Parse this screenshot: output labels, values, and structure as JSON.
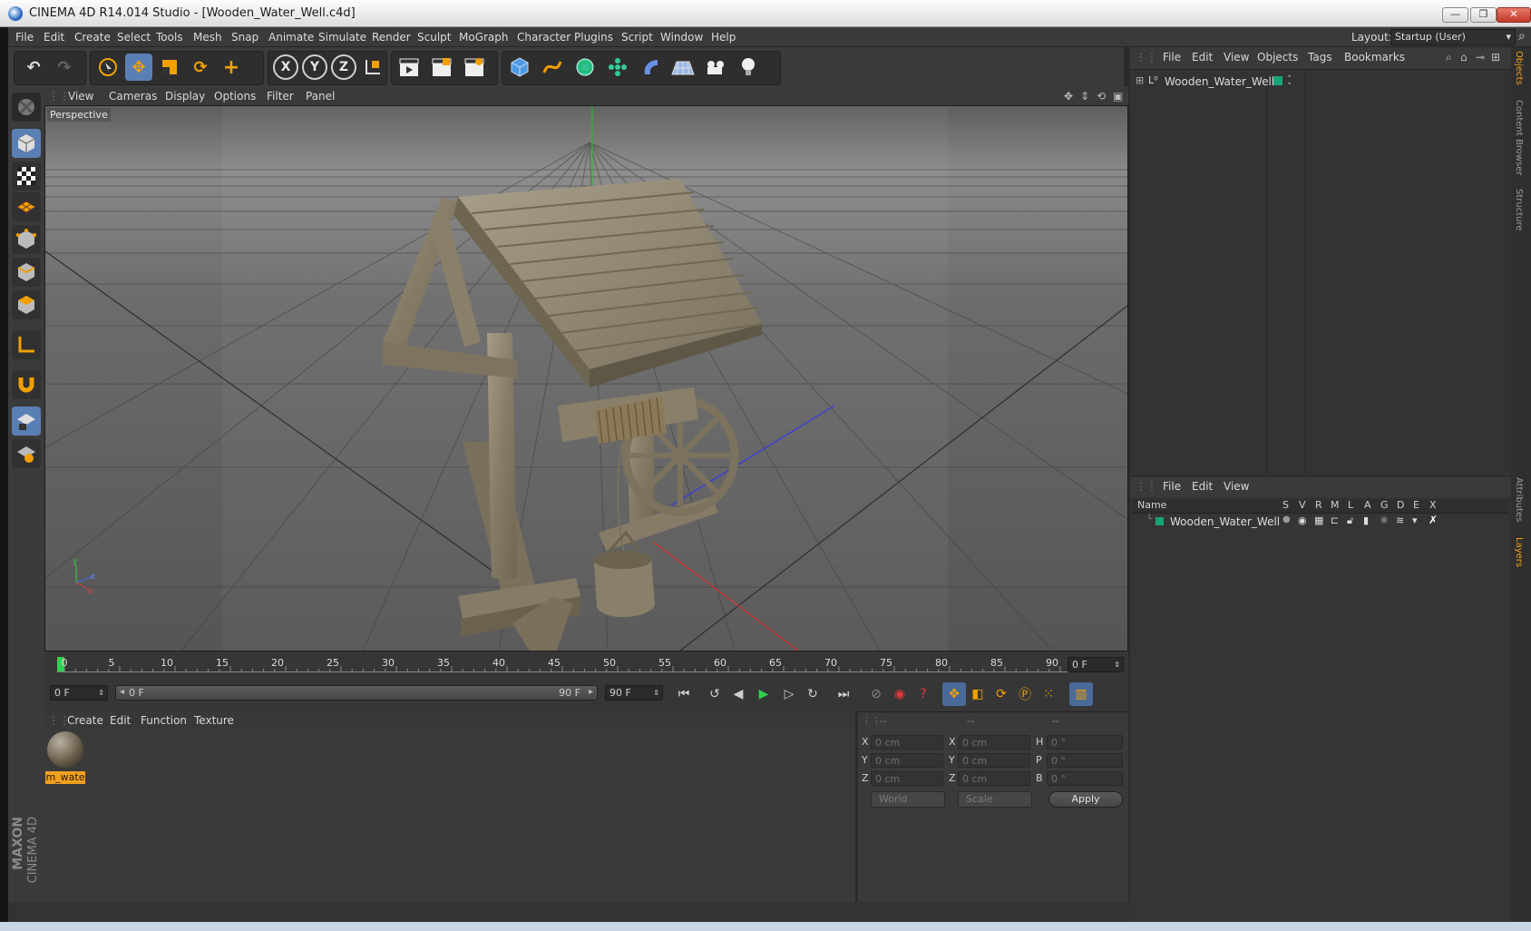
{
  "window": {
    "title": "CINEMA 4D R14.014 Studio - [Wooden_Water_Well.c4d]",
    "minimize": "—",
    "maximize": "❐",
    "close": "✕"
  },
  "menubar": [
    "File",
    "Edit",
    "Create",
    "Select",
    "Tools",
    "Mesh",
    "Snap",
    "Animate",
    "Simulate",
    "Render",
    "Sculpt",
    "MoGraph",
    "Character",
    "Plugins",
    "Script",
    "Window",
    "Help"
  ],
  "layout": {
    "label": "Layout:",
    "value": "Startup (User)"
  },
  "toolbar": {
    "axis_x": "X",
    "axis_y": "Y",
    "axis_z": "Z"
  },
  "viewport": {
    "menu": [
      "View",
      "Cameras",
      "Display",
      "Options",
      "Filter",
      "Panel"
    ],
    "label": "Perspective",
    "gizmo": {
      "x": "x",
      "y": "y",
      "z": "z"
    }
  },
  "timeline": {
    "ticks": [
      "0",
      "5",
      "10",
      "15",
      "20",
      "25",
      "30",
      "35",
      "40",
      "45",
      "50",
      "55",
      "60",
      "65",
      "70",
      "75",
      "80",
      "85",
      "90"
    ],
    "current_frame": "0 F"
  },
  "transport": {
    "start": "0 F",
    "range_start": "0 F",
    "range_end": "90 F",
    "end": "90 F"
  },
  "materials": {
    "menu": [
      "Create",
      "Edit",
      "Function",
      "Texture"
    ],
    "items": [
      {
        "label": "m_wate"
      }
    ]
  },
  "coordinates": {
    "headers": [
      "--",
      "--",
      "--"
    ],
    "rows": [
      {
        "l1": "X",
        "v1": "0 cm",
        "l2": "X",
        "v2": "0 cm",
        "l3": "H",
        "v3": "0 °"
      },
      {
        "l1": "Y",
        "v1": "0 cm",
        "l2": "Y",
        "v2": "0 cm",
        "l3": "P",
        "v3": "0 °"
      },
      {
        "l1": "Z",
        "v1": "0 cm",
        "l2": "Z",
        "v2": "0 cm",
        "l3": "B",
        "v3": "0 °"
      }
    ],
    "mode": "World",
    "transform": "Scale",
    "apply": "Apply"
  },
  "object_manager": {
    "menu": [
      "File",
      "Edit",
      "View",
      "Objects",
      "Tags",
      "Bookmarks"
    ],
    "objects": [
      {
        "name": "Wooden_Water_Well"
      }
    ]
  },
  "layer_manager": {
    "menu": [
      "File",
      "Edit",
      "View"
    ],
    "columns": [
      "Name",
      "S",
      "V",
      "R",
      "M",
      "L",
      "A",
      "G",
      "D",
      "E",
      "X"
    ],
    "layers": [
      {
        "name": "Wooden_Water_Well"
      }
    ]
  },
  "side_tabs": {
    "objects": "Objects",
    "content_browser": "Content Browser",
    "structure": "Structure",
    "attributes": "Attributes",
    "layers": "Layers"
  },
  "branding": {
    "company": "MAXON",
    "product": "CINEMA 4D"
  },
  "colors": {
    "accent": "#5a7fb5",
    "selection": "#f0a020",
    "layer": "#1aa37a"
  }
}
